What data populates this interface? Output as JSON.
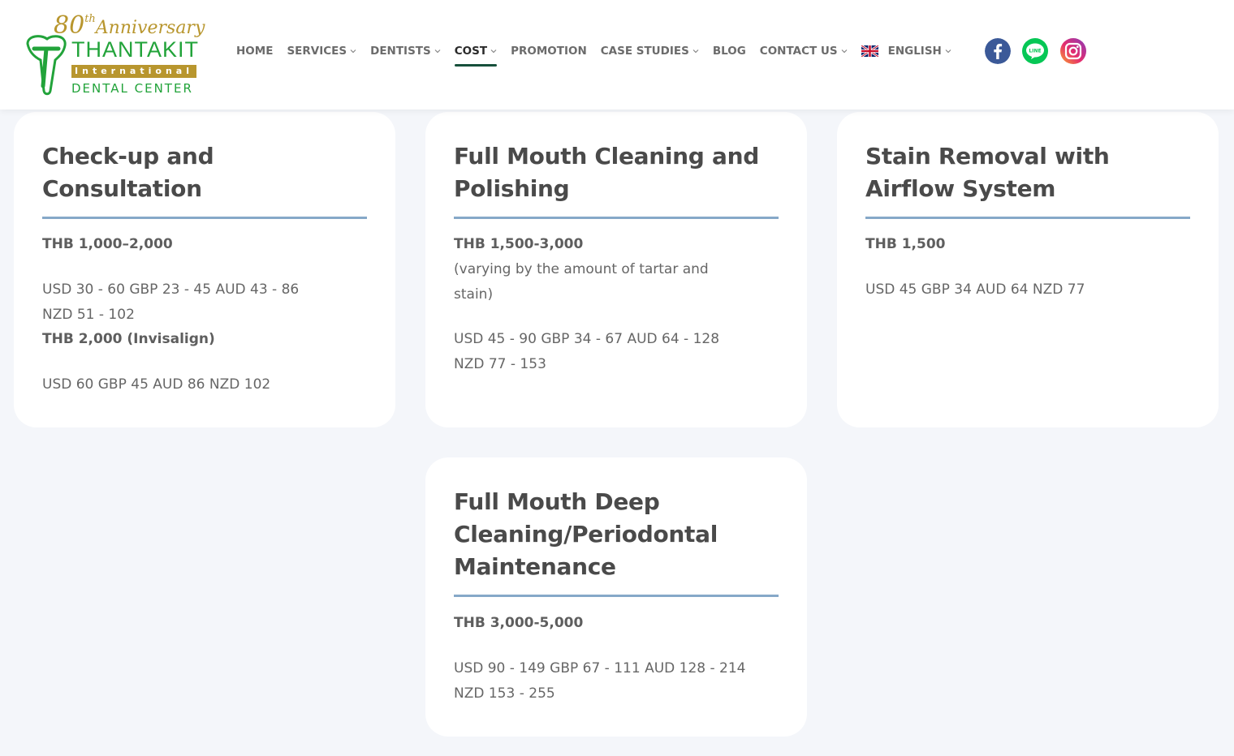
{
  "header": {
    "logo": {
      "anniversary_number": "80",
      "anniversary_suffix": "th",
      "anniversary_word": "Anniversary",
      "brand": "THANTAKIT",
      "international": "International",
      "subtitle": "DENTAL CENTER"
    },
    "nav": [
      {
        "label": "HOME",
        "dropdown": false
      },
      {
        "label": "SERVICES",
        "dropdown": true
      },
      {
        "label": "DENTISTS",
        "dropdown": true
      },
      {
        "label": "COST",
        "dropdown": true,
        "active": true
      },
      {
        "label": "PROMOTION",
        "dropdown": false
      },
      {
        "label": "CASE STUDIES",
        "dropdown": true
      },
      {
        "label": "BLOG",
        "dropdown": false
      },
      {
        "label": "CONTACT US",
        "dropdown": true
      }
    ],
    "language": "ENGLISH",
    "social": [
      "facebook-icon",
      "line-icon",
      "instagram-icon"
    ]
  },
  "cards": [
    {
      "title": "Check-up and Consultation",
      "lines": [
        {
          "text": "THB 1,000–2,000",
          "bold": true
        },
        {
          "text": "USD 30 - 60 GBP 23 - 45 AUD 43 - 86",
          "bold": false
        },
        {
          "text": "NZD 51 - 102",
          "bold": false
        },
        {
          "text": "THB 2,000 (Invisalign)",
          "bold": true
        },
        {
          "text": "USD 60 GBP 45 AUD 86 NZD 102",
          "bold": false
        }
      ]
    },
    {
      "title": "Full Mouth Cleaning and Polishing",
      "lines": [
        {
          "text": "THB 1,500-3,000",
          "bold": true
        },
        {
          "text": "(varying by the amount of tartar and",
          "bold": false
        },
        {
          "text": "stain)",
          "bold": false
        },
        {
          "text": "USD 45 - 90 GBP 34 - 67 AUD 64 - 128",
          "bold": false
        },
        {
          "text": "NZD 77 - 153",
          "bold": false
        }
      ]
    },
    {
      "title": "Stain Removal with Airflow System",
      "lines": [
        {
          "text": "THB 1,500",
          "bold": true
        },
        {
          "text": "USD 45 GBP 34 AUD 64 NZD 77",
          "bold": false
        }
      ]
    },
    {
      "title": "Full Mouth Deep Cleaning/Periodontal Maintenance",
      "lines": [
        {
          "text": "THB 3,000-5,000",
          "bold": true
        },
        {
          "text": "USD 90 - 149 GBP 67 - 111 AUD 128 - 214",
          "bold": false
        },
        {
          "text": "NZD 153 - 255",
          "bold": false
        }
      ]
    }
  ],
  "colors": {
    "brand_green": "#22a33a",
    "brand_gold": "#b8962e",
    "active_underline": "#17503b",
    "divider_blue": "#86a8c8",
    "page_bg": "#f4f6fa"
  }
}
